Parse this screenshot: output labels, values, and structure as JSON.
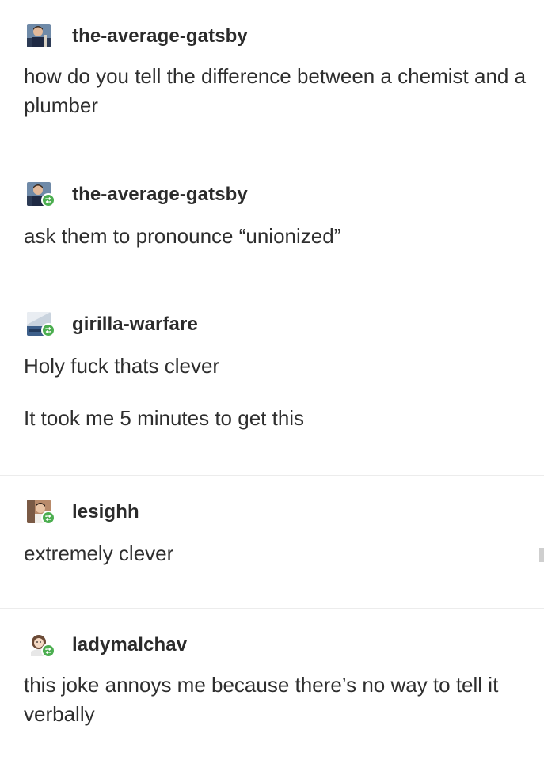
{
  "posts": [
    {
      "username": "the-average-gatsby",
      "reblog": false,
      "paragraphs": [
        "how do you tell the difference between a chemist and a plumber"
      ]
    },
    {
      "username": "the-average-gatsby",
      "reblog": true,
      "paragraphs": [
        "ask them to pronounce “unionized”"
      ]
    },
    {
      "username": "girilla-warfare",
      "reblog": true,
      "paragraphs": [
        "Holy fuck thats clever",
        "It took me 5 minutes to get this"
      ]
    },
    {
      "username": "lesighh",
      "reblog": true,
      "paragraphs": [
        "extremely clever"
      ]
    },
    {
      "username": "ladymalchav",
      "reblog": true,
      "paragraphs": [
        "this joke annoys me because there’s no way to tell it verbally"
      ]
    }
  ],
  "icons": {
    "reblog": "reblog-icon"
  },
  "colors": {
    "reblog_badge": "#4cae50",
    "text": "#2e2e2e",
    "divider": "#ececec"
  }
}
